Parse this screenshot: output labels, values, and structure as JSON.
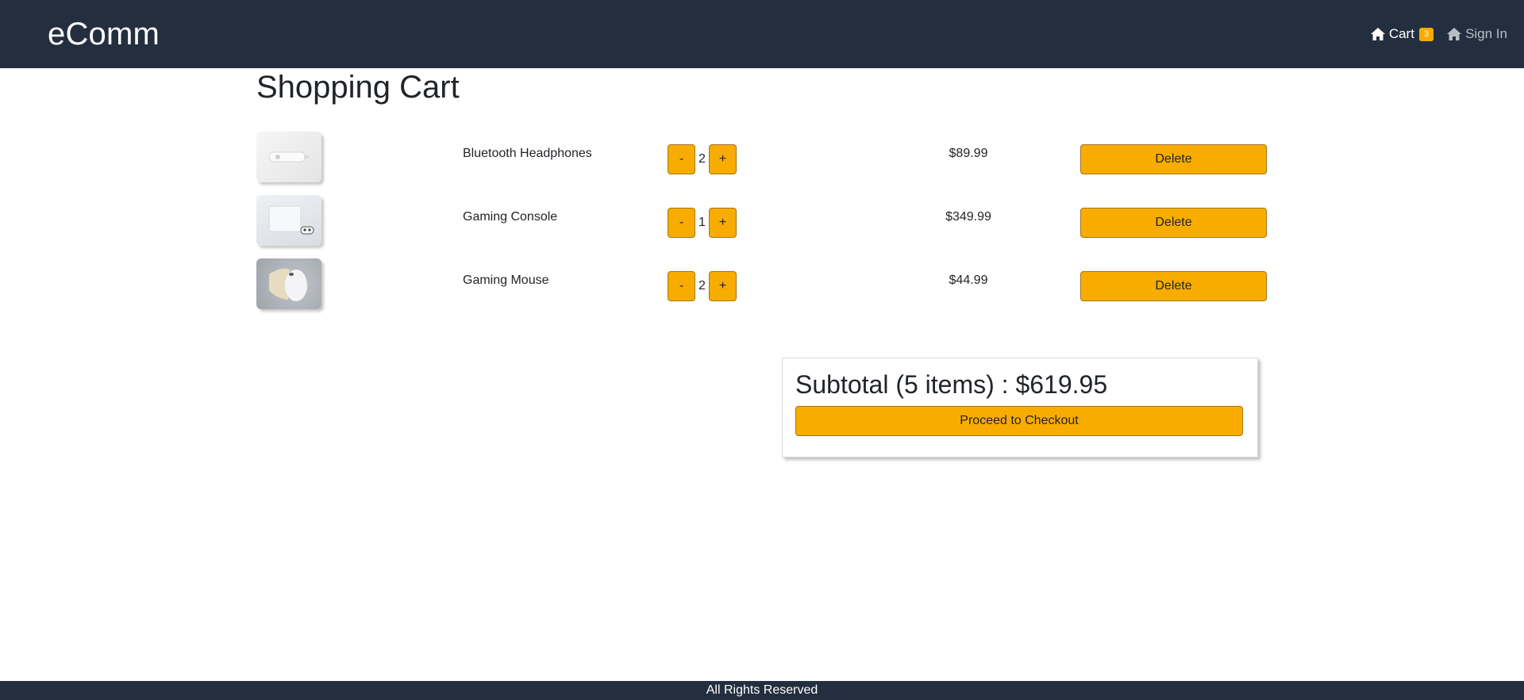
{
  "header": {
    "brand": "eComm",
    "cart_label": "Cart",
    "cart_count": "3",
    "signin_label": "Sign In",
    "cart_icon": "home-icon",
    "signin_icon": "home-icon"
  },
  "page": {
    "title": "Shopping Cart"
  },
  "cart": {
    "items": [
      {
        "image_icon": "headphones-product-image",
        "name": "Bluetooth Headphones",
        "qty": "2",
        "price": "$89.99",
        "minus": "-",
        "plus": "+",
        "delete": "Delete"
      },
      {
        "image_icon": "console-product-image",
        "name": "Gaming Console",
        "qty": "1",
        "price": "$349.99",
        "minus": "-",
        "plus": "+",
        "delete": "Delete"
      },
      {
        "image_icon": "mouse-product-image",
        "name": "Gaming Mouse",
        "qty": "2",
        "price": "$44.99",
        "minus": "-",
        "plus": "+",
        "delete": "Delete"
      }
    ]
  },
  "summary": {
    "subtotal": "Subtotal (5 items) : $619.95",
    "checkout": "Proceed to Checkout"
  },
  "footer": {
    "text": "All Rights Reserved"
  },
  "colors": {
    "navbar": "#232f3e",
    "accent": "#f8ac00"
  }
}
